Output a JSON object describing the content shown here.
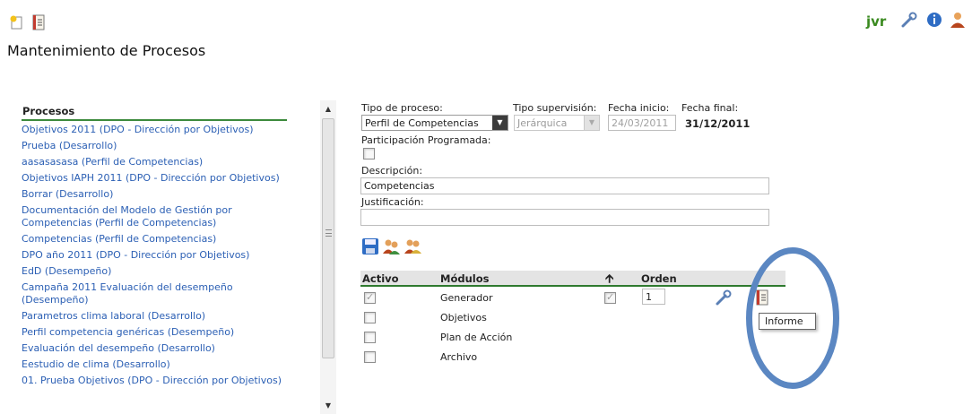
{
  "header": {
    "user_code": "jvr",
    "page_title": "Mantenimiento de Procesos",
    "left_icons": [
      "new-icon",
      "document-icon"
    ],
    "right_icons": [
      "wrench-icon",
      "info-icon",
      "user-icon"
    ]
  },
  "process_list": {
    "header": "Procesos",
    "items": [
      "Objetivos 2011 (DPO - Dirección por Objetivos)",
      "Prueba (Desarrollo)",
      "aasasasasa (Perfil de Competencias)",
      "Objetivos IAPH 2011 (DPO - Dirección por Objetivos)",
      "Borrar (Desarrollo)",
      "Documentación del Modelo de Gestión por Competencias (Perfil de Competencias)",
      "Competencias (Perfil de Competencias)",
      "DPO año 2011 (DPO - Dirección por Objetivos)",
      "EdD (Desempeño)",
      "Campaña 2011 Evaluación del desempeño (Desempeño)",
      "Parametros clima laboral (Desarrollo)",
      "Perfil competencia genéricas (Desempeño)",
      "Evaluación del desempeño (Desarrollo)",
      "Eestudio de clima (Desarrollo)",
      "01. Prueba Objetivos (DPO - Dirección por Objetivos)"
    ]
  },
  "form": {
    "tipo_proceso_label": "Tipo de proceso:",
    "tipo_proceso_value": "Perfil de Competencias",
    "tipo_supervision_label": "Tipo supervisión:",
    "tipo_supervision_value": "Jerárquica",
    "fecha_inicio_label": "Fecha inicio:",
    "fecha_inicio_value": "24/03/2011",
    "fecha_final_label": "Fecha final:",
    "fecha_final_value": "31/12/2011",
    "participacion_label": "Participación Programada:",
    "participacion_checked": false,
    "descripcion_label": "Descripción:",
    "descripcion_value": "Competencias",
    "justificacion_label": "Justificación:",
    "justificacion_value": ""
  },
  "modules_table": {
    "headers": {
      "activo": "Activo",
      "modulos": "Módulos",
      "arrow": "🡩",
      "orden": "Orden"
    },
    "rows": [
      {
        "activo": true,
        "modulo": "Generador",
        "flag": true,
        "orden": "1"
      },
      {
        "activo": false,
        "modulo": "Objetivos"
      },
      {
        "activo": false,
        "modulo": "Plan de Acción"
      },
      {
        "activo": false,
        "modulo": "Archivo"
      }
    ]
  },
  "tooltip": {
    "text": "Informe"
  },
  "colors": {
    "link": "#2b5fb4",
    "accent_green": "#3c8a3c",
    "highlight": "#5b87c2"
  }
}
